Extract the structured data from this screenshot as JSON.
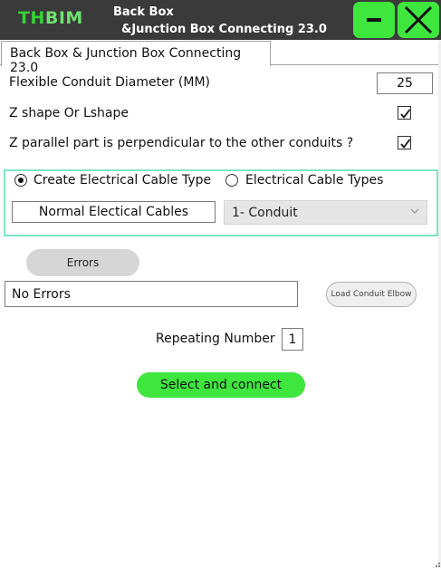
{
  "window": {
    "logo_main": "TH",
    "logo_accent": "BIM",
    "title_line1": "Back Box",
    "title_line2": "&Junction Box Connecting 23.0"
  },
  "tab": {
    "label": "Back Box & Junction Box Connecting 23.0"
  },
  "form": {
    "diameter_label": "Flexible Conduit Diameter (MM)",
    "diameter_value": "25",
    "zshape_label": "Z shape Or Lshape",
    "zshape_checked": true,
    "zparallel_label": "Z parallel part is perpendicular to the other conduits ?",
    "zparallel_checked": true
  },
  "cable_group": {
    "create_label": "Create Electrical Cable Type",
    "create_selected": true,
    "types_label": "Electrical Cable Types",
    "types_selected": false,
    "cable_name_value": "Normal Electical Cables",
    "conduit_type_selected": "1- Conduit"
  },
  "errors": {
    "button_label": "Errors",
    "message": "No Errors"
  },
  "load_elbow_label": "Load Conduit Elbow",
  "repeating": {
    "label": "Repeating Number",
    "value": "1"
  },
  "select_button_label": "Select and connect",
  "colors": {
    "titlebar": "#3a3a3a",
    "accent_green": "#3ee63e",
    "group_border": "#7ee6c8"
  },
  "icons": {
    "minimize": "minimize-icon",
    "close": "close-icon",
    "dropdown": "chevron-down-icon",
    "check": "check-icon"
  }
}
